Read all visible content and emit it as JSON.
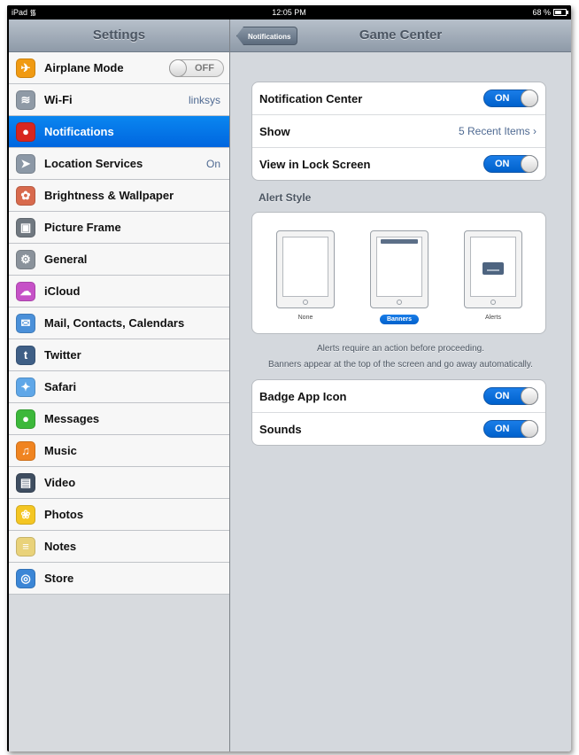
{
  "status_bar": {
    "device": "iPad",
    "wifi_icon": "wifi-icon",
    "time": "12:05 PM",
    "battery": "68 %",
    "battery_level": 0.68
  },
  "sidebar": {
    "title": "Settings",
    "items": [
      {
        "label": "Airplane Mode",
        "icon": "airplane-icon",
        "color": "#f09a12",
        "glyph": "✈",
        "toggle": "OFF"
      },
      {
        "label": "Wi-Fi",
        "icon": "wifi-icon",
        "color": "#8f9aa6",
        "glyph": "≋",
        "value": "linksys"
      },
      {
        "label": "Notifications",
        "icon": "notifications-icon",
        "color": "#d8261f",
        "glyph": "●",
        "selected": true
      },
      {
        "label": "Location Services",
        "icon": "location-icon",
        "color": "#8c98a6",
        "glyph": "➤",
        "value": "On"
      },
      {
        "label": "Brightness & Wallpaper",
        "icon": "brightness-wallpaper-icon",
        "color": "#d86a4d",
        "glyph": "✿"
      },
      {
        "label": "Picture Frame",
        "icon": "picture-frame-icon",
        "color": "#707880",
        "glyph": "▣"
      },
      {
        "label": "General",
        "icon": "gear-icon",
        "color": "#8a929b",
        "glyph": "⚙"
      },
      {
        "label": "iCloud",
        "icon": "icloud-icon",
        "color": "#c651c7",
        "glyph": "☁"
      },
      {
        "label": "Mail, Contacts, Calendars",
        "icon": "mail-icon",
        "color": "#4a90d9",
        "glyph": "✉"
      },
      {
        "label": "Twitter",
        "icon": "twitter-icon",
        "color": "#3f5f86",
        "glyph": "t"
      },
      {
        "label": "Safari",
        "icon": "safari-icon",
        "color": "#5fa7e8",
        "glyph": "✦"
      },
      {
        "label": "Messages",
        "icon": "messages-icon",
        "color": "#3cb83a",
        "glyph": "●"
      },
      {
        "label": "Music",
        "icon": "music-icon",
        "color": "#f08420",
        "glyph": "♫"
      },
      {
        "label": "Video",
        "icon": "video-icon",
        "color": "#3e4d60",
        "glyph": "▤"
      },
      {
        "label": "Photos",
        "icon": "photos-icon",
        "color": "#f4c623",
        "glyph": "❀"
      },
      {
        "label": "Notes",
        "icon": "notes-icon",
        "color": "#e9d27a",
        "glyph": "≡"
      },
      {
        "label": "Store",
        "icon": "store-icon",
        "color": "#3b86d6",
        "glyph": "◎"
      }
    ]
  },
  "navbar": {
    "back_label": "Notifications",
    "title": "Game Center"
  },
  "group1": [
    {
      "label": "Notification Center",
      "toggle": "ON"
    },
    {
      "label": "Show",
      "value": "5 Recent Items ›"
    },
    {
      "label": "View in Lock Screen",
      "toggle": "ON"
    }
  ],
  "alert_style": {
    "title": "Alert Style",
    "options": [
      "None",
      "Banners",
      "Alerts"
    ],
    "selected": "Banners",
    "footnote_line1": "Alerts require an action before proceeding.",
    "footnote_line2": "Banners appear at the top of the screen and go away automatically."
  },
  "group2": [
    {
      "label": "Badge App Icon",
      "toggle": "ON"
    },
    {
      "label": "Sounds",
      "toggle": "ON"
    }
  ]
}
